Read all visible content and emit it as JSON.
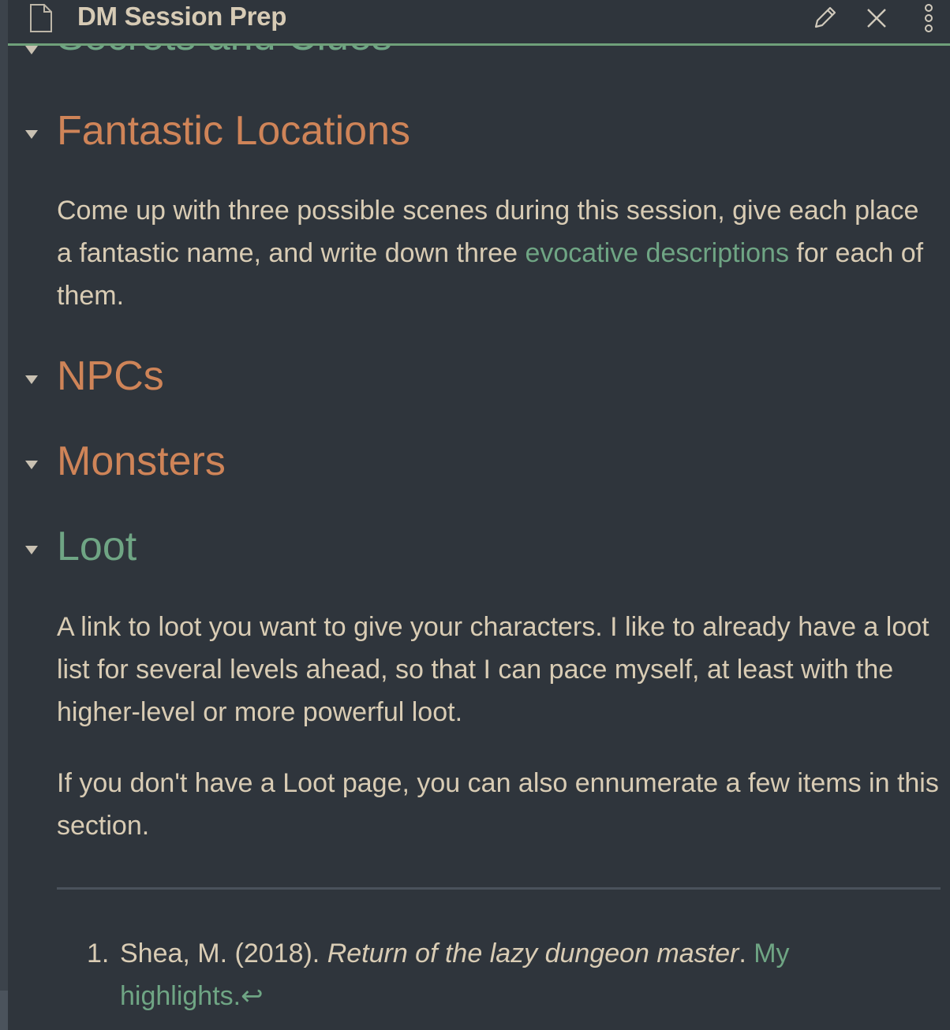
{
  "header": {
    "title": "DM Session Prep",
    "icons": {
      "file": "file-icon",
      "edit": "pencil-icon",
      "close": "close-icon",
      "more": "more-vertical-icon"
    }
  },
  "sections": {
    "secrets": {
      "heading": "Secrets and Clues"
    },
    "locations": {
      "heading": "Fantastic Locations",
      "text_before": "Come up with three possible scenes during this session, give each place a fantastic name, and write down three ",
      "link": "evocative descriptions",
      "text_after": " for each of them."
    },
    "npcs": {
      "heading": "NPCs"
    },
    "monsters": {
      "heading": "Monsters"
    },
    "loot": {
      "heading": "Loot",
      "para1": "A link to loot you want to give your characters. I like to already have a loot list for several levels ahead, so that I can pace myself, at least with the higher-level or more powerful loot.",
      "para2": "If you don't have a Loot page, you can also ennumerate a few items in this section."
    }
  },
  "footnotes": [
    {
      "number": "1.",
      "author": "Shea, M. (2018). ",
      "title": "Return of the lazy dungeon master",
      "sep": ". ",
      "link": "My highlights.",
      "backref": "↩"
    }
  ],
  "colors": {
    "background": "#2f353c",
    "heading_orange": "#cf8458",
    "heading_green": "#6fa584",
    "text": "#d9ccb4",
    "accent_line": "#6fa07a"
  }
}
